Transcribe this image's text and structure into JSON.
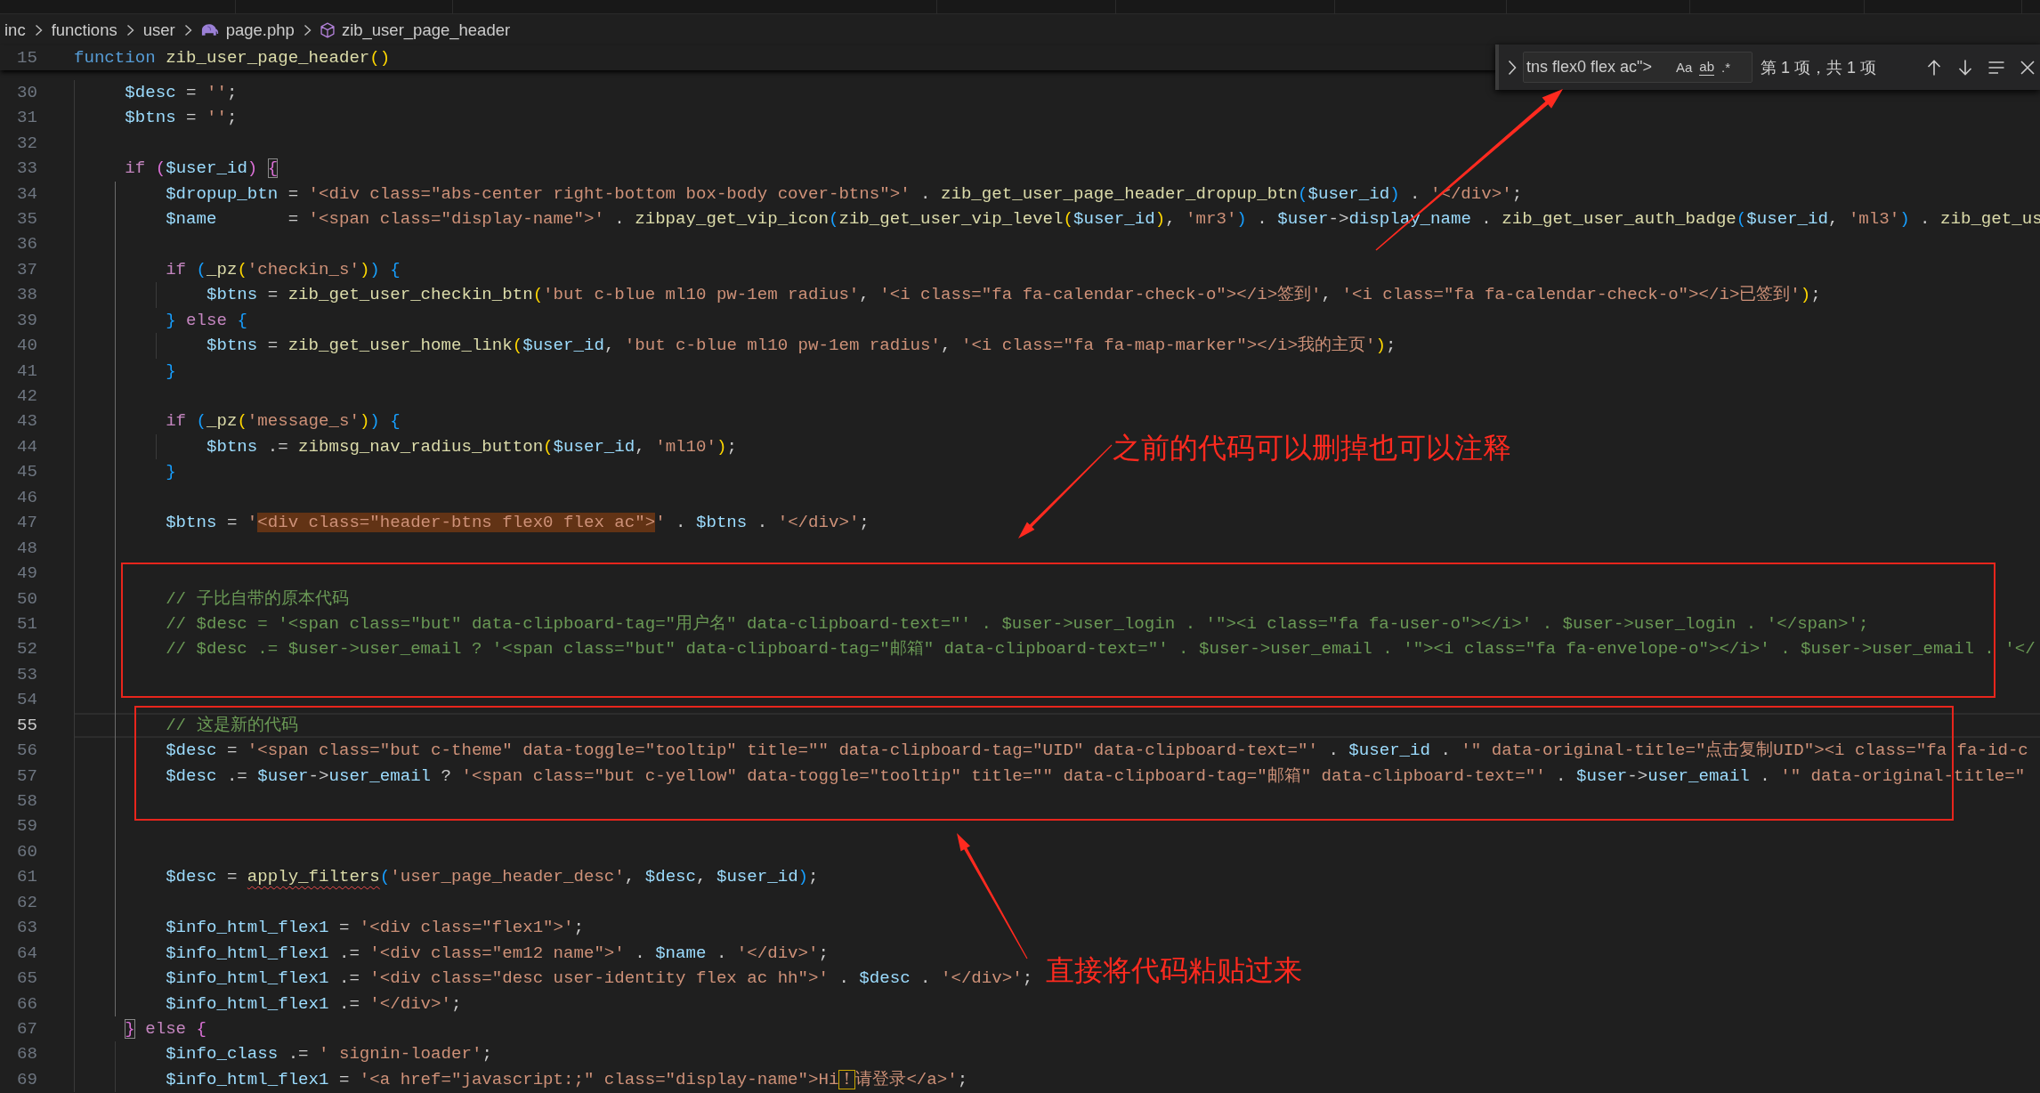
{
  "breadcrumbs": [
    {
      "label": "inc",
      "kind": "folder"
    },
    {
      "label": "functions",
      "kind": "folder"
    },
    {
      "label": "user",
      "kind": "folder"
    },
    {
      "label": "page.php",
      "kind": "php-file"
    },
    {
      "label": "zib_user_page_header",
      "kind": "function"
    }
  ],
  "sticky_line": {
    "number": "15",
    "text": "function zib_user_page_header()"
  },
  "find_widget": {
    "value": "tns flex0 flex ac\">",
    "options": [
      "Aa",
      "ab",
      ".*"
    ],
    "result": "第 1 项，共 1 项"
  },
  "editor": {
    "lines": [
      {
        "number": "30",
        "text": "    $desc = '';",
        "current": false
      },
      {
        "number": "31",
        "text": "    $btns = '';",
        "current": false
      },
      {
        "number": "32",
        "current": false
      },
      {
        "number": "33",
        "parts": [
          {
            "text": "    if ($user_id) "
          },
          {
            "text": "{",
            "kind": "bracket-match"
          }
        ],
        "current": false
      },
      {
        "number": "34",
        "text": "        $dropup_btn = '<div class=\"abs-center right-bottom box-body cover-btns\">' . zib_get_user_page_header_dropup_btn($user_id) . '</div>';",
        "current": false
      },
      {
        "number": "35",
        "text": "        $name       = '<span class=\"display-name\">' . zibpay_get_vip_icon(zib_get_user_vip_level($user_id), 'mr3') . $user->display_name . zib_get_user_auth_badge($user_id, 'ml3') . zib_get_us",
        "current": false
      },
      {
        "number": "36",
        "current": false
      },
      {
        "number": "37",
        "text": "        if (_pz('checkin_s')) {",
        "current": false
      },
      {
        "number": "38",
        "text": "            $btns = zib_get_user_checkin_btn('but c-blue ml10 pw-1em radius', '<i class=\"fa fa-calendar-check-o\"></i>签到', '<i class=\"fa fa-calendar-check-o\"></i>已签到');",
        "current": false
      },
      {
        "number": "39",
        "text": "        } else {",
        "current": false
      },
      {
        "number": "40",
        "text": "            $btns = zib_get_user_home_link($user_id, 'but c-blue ml10 pw-1em radius', '<i class=\"fa fa-map-marker\"></i>我的主页');",
        "current": false
      },
      {
        "number": "41",
        "text": "        }",
        "current": false
      },
      {
        "number": "42",
        "current": false
      },
      {
        "number": "43",
        "text": "        if (_pz('message_s')) {",
        "current": false
      },
      {
        "number": "44",
        "text": "            $btns .= zibmsg_nav_radius_button($user_id, 'ml10');",
        "current": false
      },
      {
        "number": "45",
        "text": "        }",
        "current": false
      },
      {
        "number": "46",
        "current": false
      },
      {
        "number": "47",
        "parts": [
          {
            "text": "        $btns = '"
          },
          {
            "text": "<div class=\"header-btns flex0 flex ac\">",
            "kind": "find-match"
          },
          {
            "text": "' . $btns . '</div>';"
          }
        ],
        "current": false
      },
      {
        "number": "48",
        "current": false
      },
      {
        "number": "49",
        "current": false
      },
      {
        "number": "50",
        "text": "        // 子比自带的原本代码",
        "current": false
      },
      {
        "number": "51",
        "text": "        // $desc = '<span class=\"but\" data-clipboard-tag=\"用户名\" data-clipboard-text=\"' . $user->user_login . '\"><i class=\"fa fa-user-o\"></i>' . $user->user_login . '</span>';",
        "current": false
      },
      {
        "number": "52",
        "text": "        // $desc .= $user->user_email ? '<span class=\"but\" data-clipboard-tag=\"邮箱\" data-clipboard-text=\"' . $user->user_email . '\"><i class=\"fa fa-envelope-o\"></i>' . $user->user_email . '</",
        "current": false
      },
      {
        "number": "53",
        "current": false
      },
      {
        "number": "54",
        "current": false
      },
      {
        "number": "55",
        "text": "        // 这是新的代码",
        "current": true
      },
      {
        "number": "56",
        "text": "        $desc = '<span class=\"but c-theme\" data-toggle=\"tooltip\" title=\"\" data-clipboard-tag=\"UID\" data-clipboard-text=\"' . $user_id . '\" data-original-title=\"点击复制UID\"><i class=\"fa fa-id-c",
        "current": false
      },
      {
        "number": "57",
        "text": "        $desc .= $user->user_email ? '<span class=\"but c-yellow\" data-toggle=\"tooltip\" title=\"\" data-clipboard-tag=\"邮箱\" data-clipboard-text=\"' . $user->user_email . '\" data-original-title=\"",
        "current": false
      },
      {
        "number": "58",
        "current": false
      },
      {
        "number": "59",
        "current": false
      },
      {
        "number": "60",
        "current": false
      },
      {
        "number": "61",
        "parts": [
          {
            "text": "        $desc = "
          },
          {
            "text": "apply_filters",
            "kind": "squiggle"
          },
          {
            "text": "('user_page_header_desc', $desc, $user_id);"
          }
        ],
        "current": false
      },
      {
        "number": "62",
        "current": false
      },
      {
        "number": "63",
        "text": "        $info_html_flex1 = '<div class=\"flex1\">';",
        "current": false
      },
      {
        "number": "64",
        "text": "        $info_html_flex1 .= '<div class=\"em12 name\">' . $name . '</div>';",
        "current": false
      },
      {
        "number": "65",
        "text": "        $info_html_flex1 .= '<div class=\"desc user-identity flex ac hh\">' . $desc . '</div>';",
        "current": false
      },
      {
        "number": "66",
        "text": "        $info_html_flex1 .= '</div>';",
        "current": false
      },
      {
        "number": "67",
        "parts": [
          {
            "text": "    }",
            "kind": "bracket-match"
          },
          {
            "text": " else {"
          }
        ],
        "current": false
      },
      {
        "number": "68",
        "text": "        $info_class .= ' signin-loader';",
        "current": false
      },
      {
        "number": "69",
        "parts": [
          {
            "text": "        $info_html_flex1 = '<a href=\"javascript:;\" class=\"display-name\">Hi"
          },
          {
            "text": "！",
            "kind": "ambiguous"
          },
          {
            "text": "请登录</a>';"
          }
        ],
        "current": false
      }
    ]
  },
  "annotations": [
    {
      "text": "之前的代码可以删掉也可以注释"
    },
    {
      "text": "直接将代码粘贴过来"
    }
  ]
}
